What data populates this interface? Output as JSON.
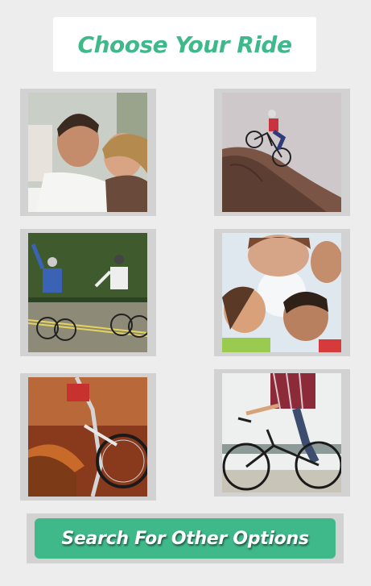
{
  "header": {
    "title": "Choose Your Ride"
  },
  "colors": {
    "accent": "#3fb88a",
    "tile_frame": "#d2d2d2",
    "background": "#ededed"
  },
  "tiles": [
    {
      "name": "couple-photo"
    },
    {
      "name": "mountain-biker-photo"
    },
    {
      "name": "road-cyclists-photo"
    },
    {
      "name": "kids-circle-photo"
    },
    {
      "name": "dirt-bike-photo"
    },
    {
      "name": "city-bike-photo"
    }
  ],
  "footer": {
    "search_label": "Search For Other Options"
  }
}
